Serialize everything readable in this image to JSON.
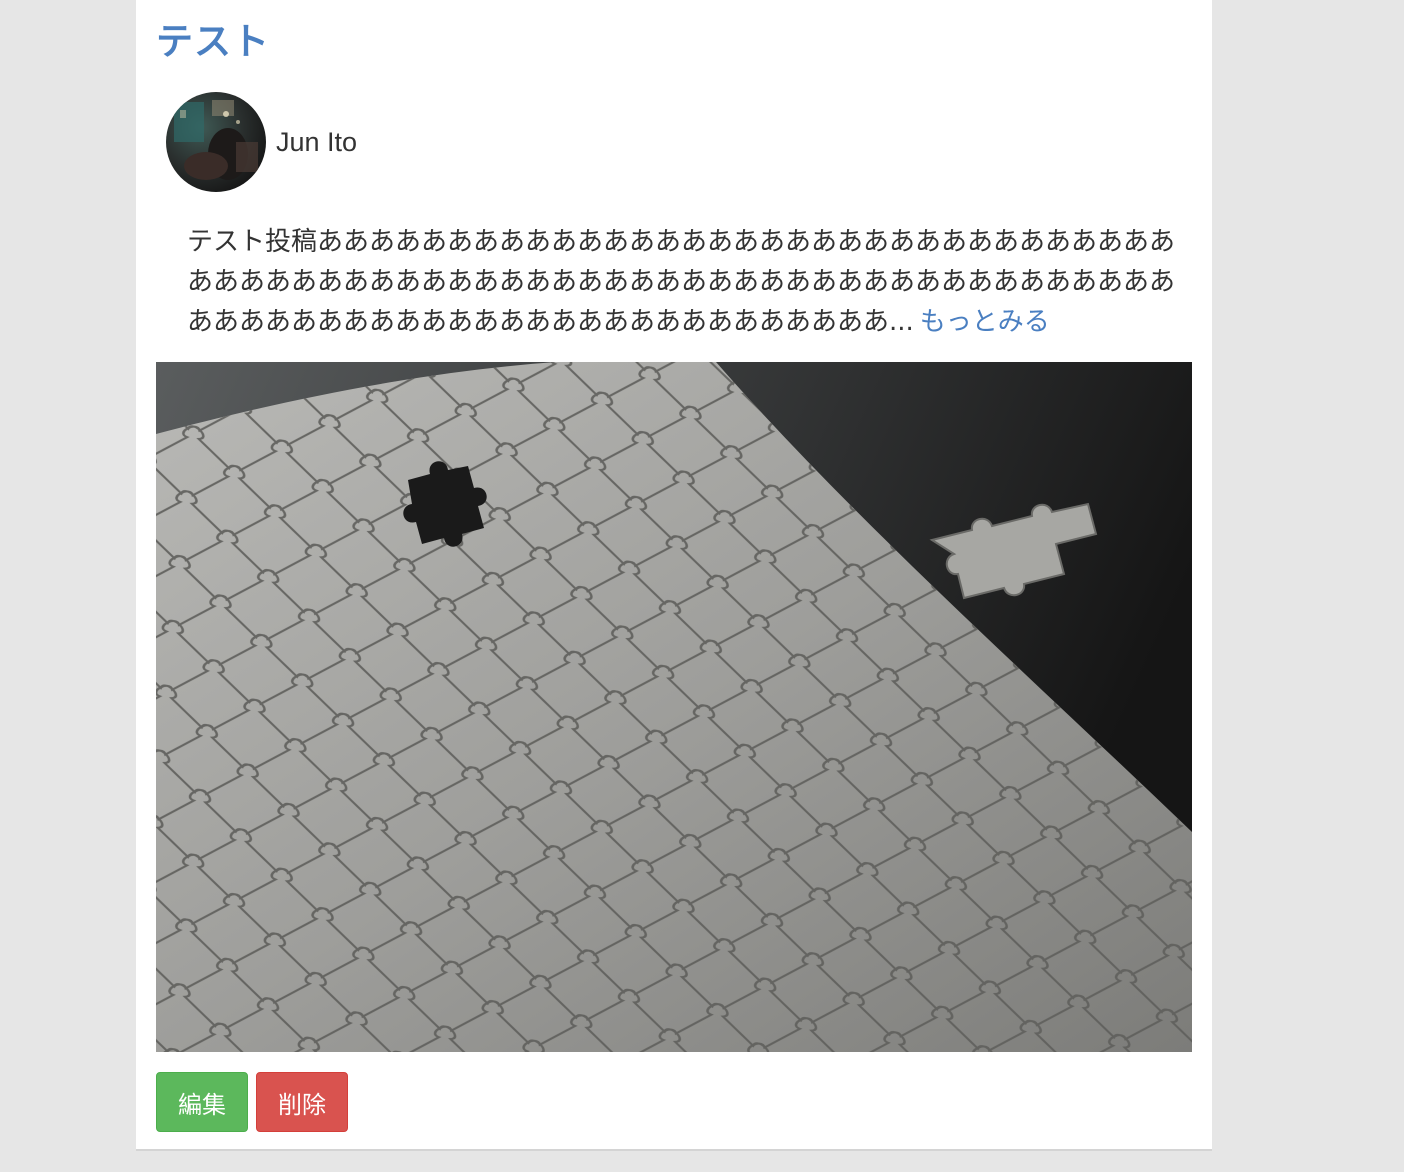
{
  "post": {
    "title": "テスト",
    "author": {
      "name": "Jun Ito"
    },
    "body": "テスト投稿ああああああああああああああああああああああああああああああああああああああああああああああああああああああああああああああああああああああああああああああああああああああああああああああああああ...",
    "more_label": "もっとみる"
  },
  "actions": {
    "edit_label": "編集",
    "delete_label": "削除"
  },
  "colors": {
    "link": "#4a7fc1",
    "edit_button": "#5cb85c",
    "delete_button": "#d9534f",
    "page_background": "#e6e6e6"
  }
}
